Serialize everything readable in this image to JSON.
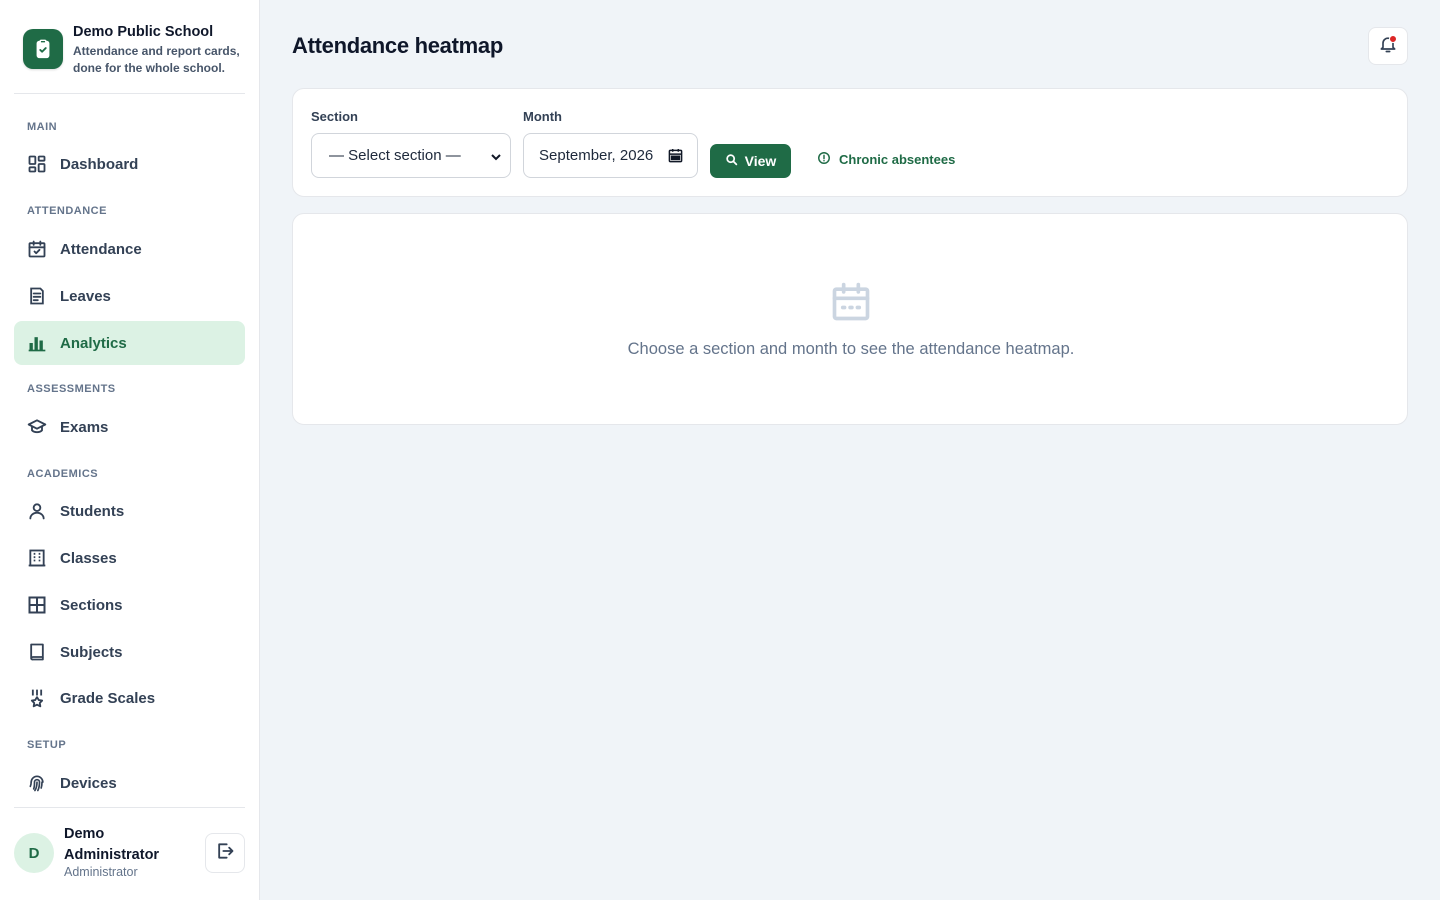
{
  "brand": {
    "name": "Demo Public School",
    "tagline": "Attendance and report cards, done for the whole school."
  },
  "nav": {
    "sections": {
      "main": "MAIN",
      "attendance": "ATTENDANCE",
      "assessments": "ASSESSMENTS",
      "academics": "ACADEMICS",
      "setup": "SETUP"
    },
    "items": {
      "dashboard": "Dashboard",
      "attendance": "Attendance",
      "leaves": "Leaves",
      "analytics": "Analytics",
      "exams": "Exams",
      "students": "Students",
      "classes": "Classes",
      "sections": "Sections",
      "subjects": "Subjects",
      "grade_scales": "Grade Scales",
      "devices": "Devices"
    },
    "active": "analytics"
  },
  "user": {
    "initial": "D",
    "name": "Demo Administrator",
    "role": "Administrator"
  },
  "page": {
    "title": "Attendance heatmap"
  },
  "filters": {
    "section_label": "Section",
    "section_value": "— Select section —",
    "month_label": "Month",
    "month_value": "September, 2026",
    "view_button": "View",
    "chronic_link": "Chronic absentees"
  },
  "empty_state": {
    "message": "Choose a section and month to see the attendance heatmap."
  },
  "colors": {
    "accent": "#1f6b46",
    "accent_light": "#dcf2e4",
    "notification_dot": "#dc2626",
    "background": "#f0f4f8"
  },
  "icons": {
    "brand": "clipboard-check-icon",
    "dashboard": "dashboard-icon",
    "attendance": "calendar-check-icon",
    "leaves": "document-icon",
    "analytics": "bar-chart-icon",
    "exams": "graduation-cap-icon",
    "students": "user-icon",
    "classes": "building-icon",
    "sections": "grid-icon",
    "subjects": "book-icon",
    "grade_scales": "award-icon",
    "devices": "fingerprint-icon",
    "logout": "logout-icon",
    "notifications": "bell-icon",
    "empty": "calendar-icon"
  }
}
